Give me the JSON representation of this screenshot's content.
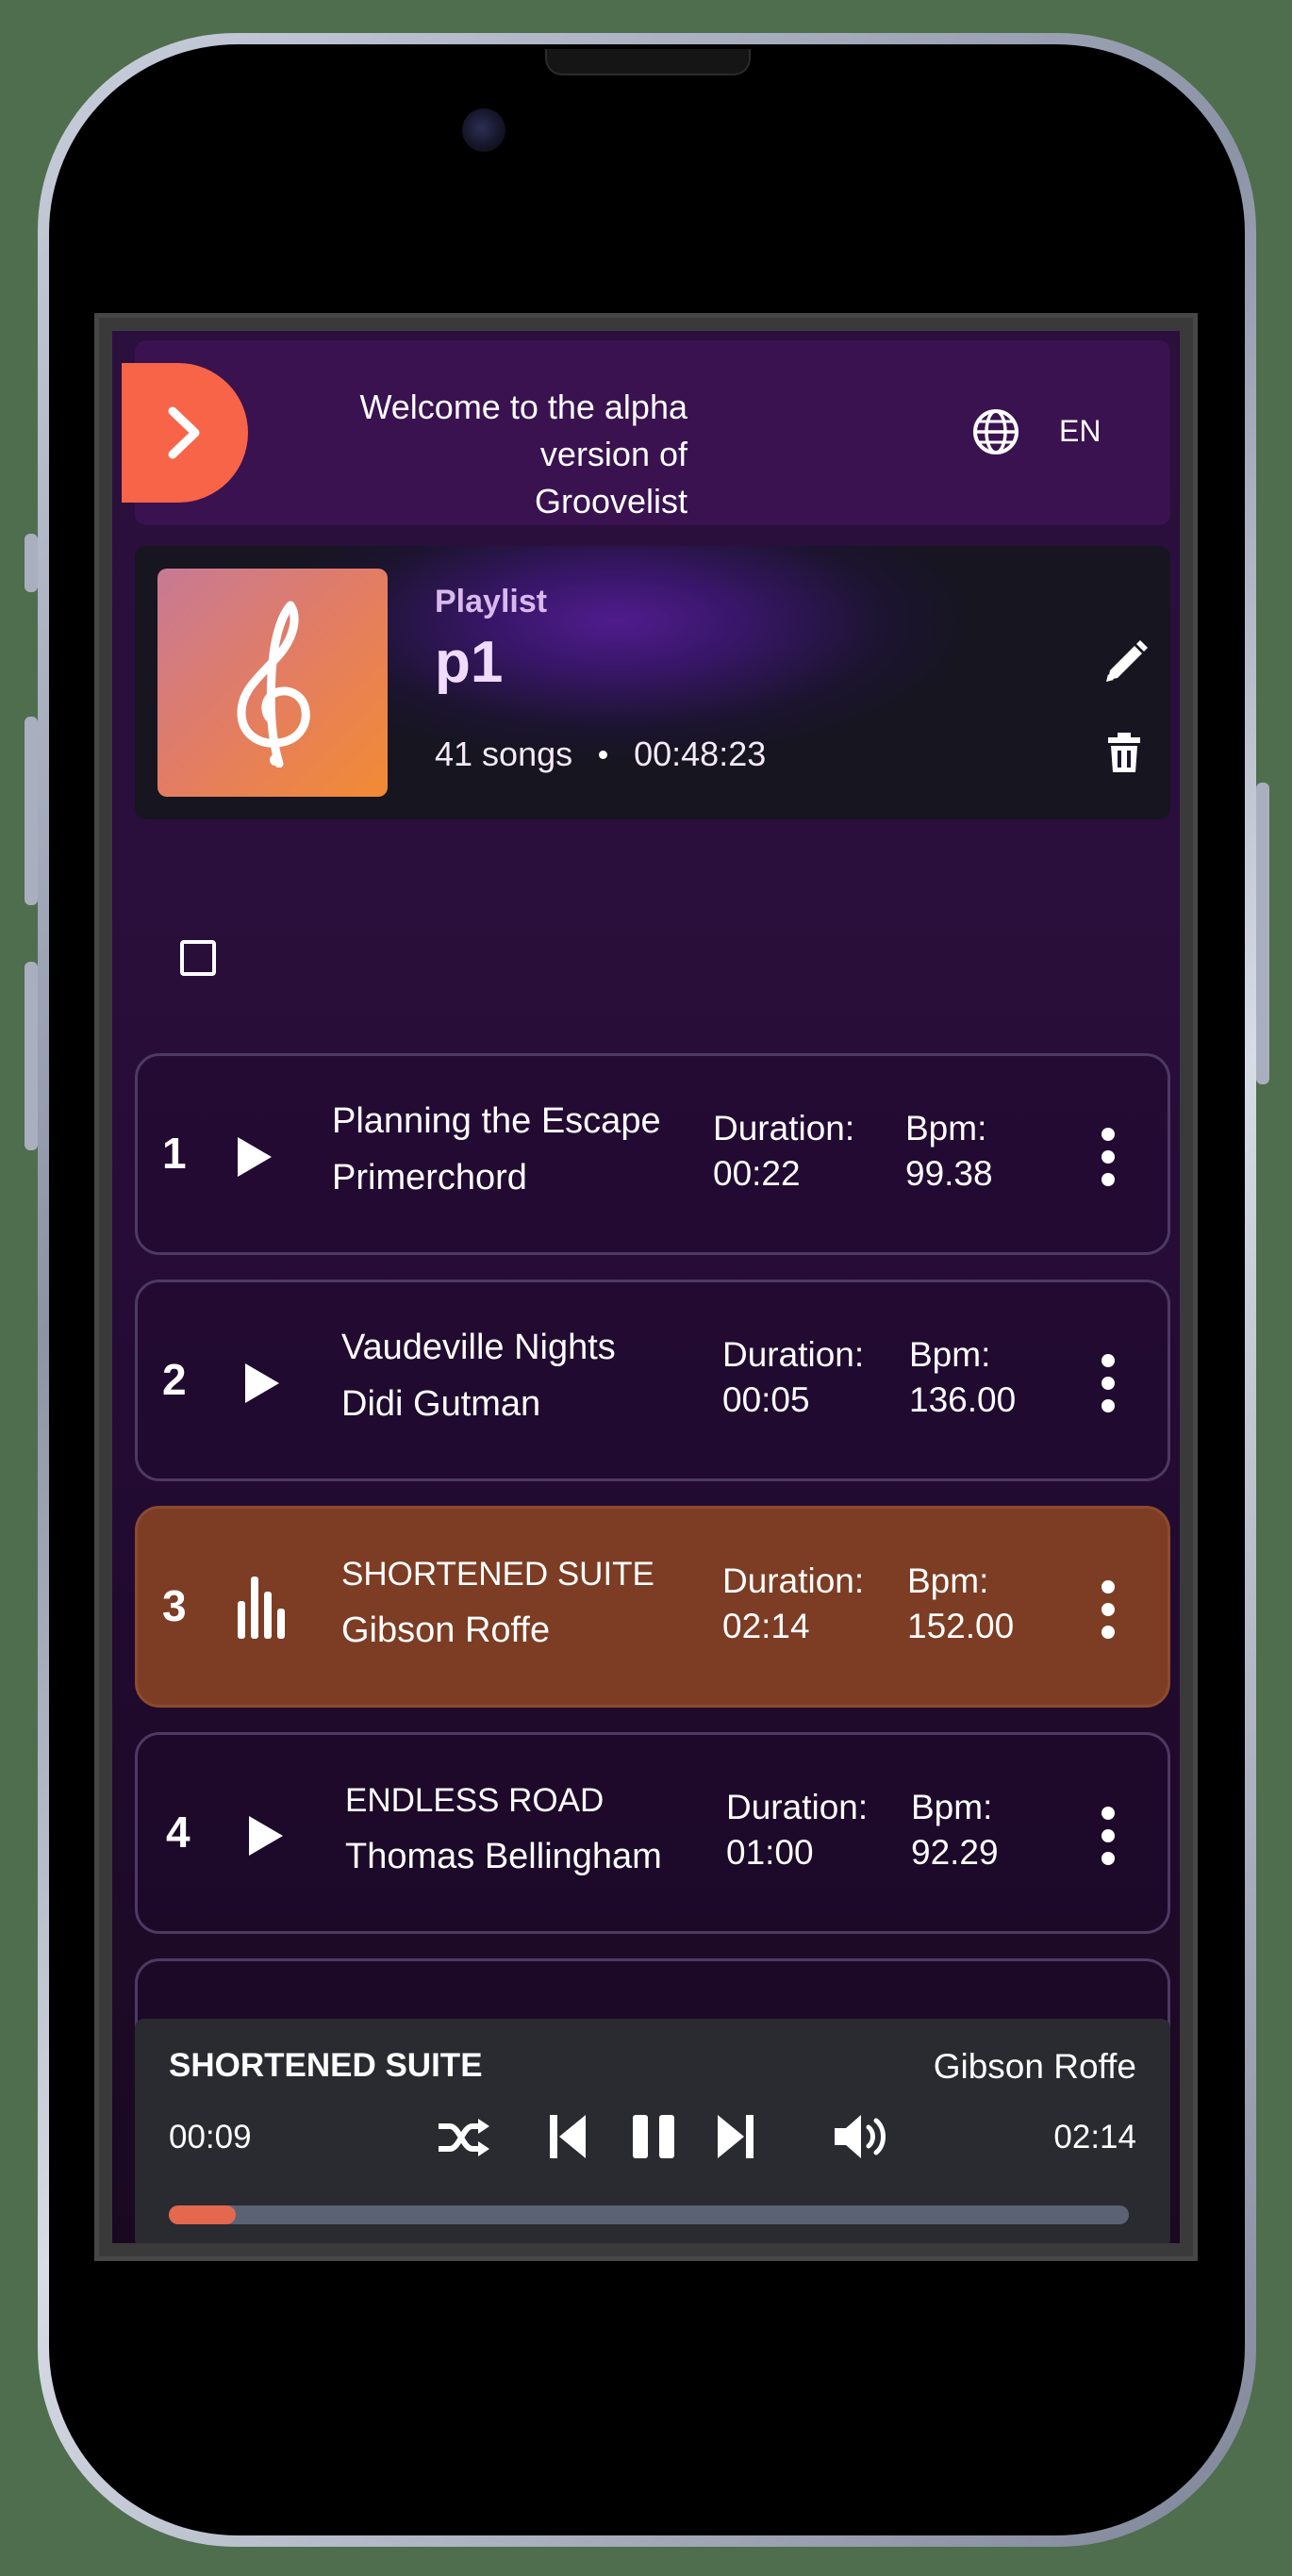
{
  "banner": {
    "welcome_line1": "Welcome to the alpha version of",
    "welcome_line2": "Groovelist",
    "language": "EN",
    "icons": [
      "chevron-right-icon",
      "globe-icon"
    ]
  },
  "playlist": {
    "kicker": "Playlist",
    "name": "p1",
    "song_count": "41 songs",
    "total_duration": "00:48:23",
    "cover_icon": "treble-clef-icon",
    "actions": [
      "pencil-icon",
      "trash-icon"
    ]
  },
  "tracks": [
    {
      "number": "1",
      "title": "Planning the Escape",
      "artist": "Primerchord",
      "duration_label": "Duration:",
      "duration": "00:22",
      "bpm_label": "Bpm:",
      "bpm": "99.38",
      "state": "idle"
    },
    {
      "number": "2",
      "title": "Vaudeville Nights",
      "artist": "Didi Gutman",
      "duration_label": "Duration:",
      "duration": "00:05",
      "bpm_label": "Bpm:",
      "bpm": "136.00",
      "state": "idle"
    },
    {
      "number": "3",
      "title": "SHORTENED SUITE",
      "artist": "Gibson Roffe",
      "duration_label": "Duration:",
      "duration": "02:14",
      "bpm_label": "Bpm:",
      "bpm": "152.00",
      "state": "playing"
    },
    {
      "number": "4",
      "title": "ENDLESS ROAD",
      "artist": "Thomas Bellingham",
      "duration_label": "Duration:",
      "duration": "01:00",
      "bpm_label": "Bpm:",
      "bpm": "92.29",
      "state": "idle"
    }
  ],
  "player": {
    "title": "SHORTENED SUITE",
    "artist": "Gibson Roffe",
    "elapsed": "00:09",
    "total": "02:14",
    "progress_fraction": 0.07,
    "controls": [
      "shuffle-icon",
      "skip-previous-icon",
      "pause-icon",
      "skip-next-icon",
      "volume-icon"
    ]
  },
  "colors": {
    "accent": "#f86447",
    "active_row": "#7c3d24",
    "progress": "#e3684d",
    "background": "#2b0f3c"
  }
}
